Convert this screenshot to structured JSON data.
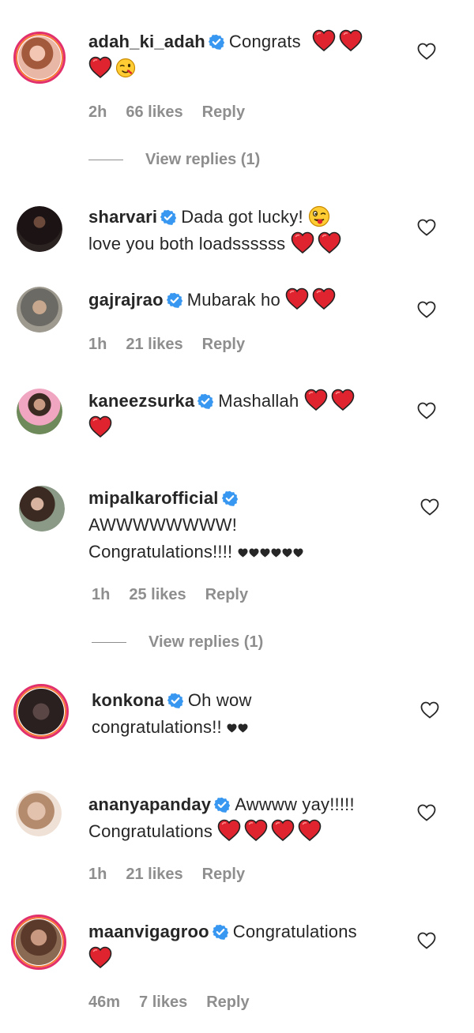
{
  "comments": [
    {
      "user": "adah_ki_adah",
      "text": "Congrats",
      "time": "2h",
      "likes": "66 likes",
      "reply": "Reply",
      "view_replies": "View replies (1)"
    },
    {
      "user": "sharvari",
      "text": "Dada got lucky!",
      "text2": "love you both loadssssss"
    },
    {
      "user": "gajrajrao",
      "text": "Mubarak ho",
      "time": "1h",
      "likes": "21 likes",
      "reply": "Reply"
    },
    {
      "user": "kaneezsurka",
      "text": "Mashallah"
    },
    {
      "user": "mipalkarofficial",
      "text": "AWWWWWWWW!",
      "text2": "Congratulations!!!!",
      "time": "1h",
      "likes": "25 likes",
      "reply": "Reply",
      "view_replies": "View replies (1)"
    },
    {
      "user": "konkona",
      "text": "Oh wow",
      "text2": "congratulations!!"
    },
    {
      "user": "ananyapanday",
      "text": "Awwww yay!!!!!",
      "text2": "Congratulations",
      "time": "1h",
      "likes": "21 likes",
      "reply": "Reply"
    },
    {
      "user": "maanvigagroo",
      "text": "Congratulations",
      "time": "46m",
      "likes": "7 likes",
      "reply": "Reply"
    }
  ],
  "icons": {
    "verified": "verified-badge-icon",
    "like": "heart-outline-icon",
    "heart_emoji": "red-heart-emoji",
    "black_heart": "black-heart-emoji"
  },
  "colors": {
    "verified": "#3897f0",
    "heart": "#e0242f",
    "meta": "#8e8e8e",
    "ring": "#e1306c"
  }
}
